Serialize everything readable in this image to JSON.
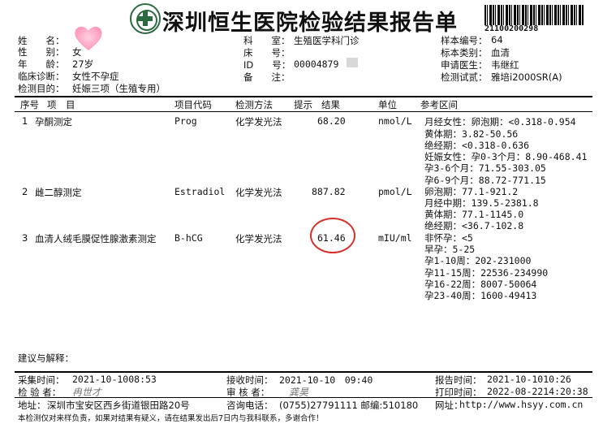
{
  "header": {
    "title": "深圳恒生医院检验结果报告单",
    "barcode_number": "21100200298"
  },
  "patient": {
    "name_label": "姓　　名：",
    "gender_label": "性　　别：",
    "gender": "女",
    "age_label": "年　　龄：",
    "age": "27岁",
    "diagnosis_label": "临床诊断：",
    "diagnosis": "女性不孕症",
    "purpose_label": "检测目的：",
    "purpose": "妊娠三项（生殖专用）",
    "dept_label": "科　　室：",
    "dept": "生殖医学科门诊",
    "bed_label": "床　　号：",
    "id_label": "ID　　号：",
    "id": "00004879",
    "remark_label": "备　　注：",
    "sample_no_label": "样本编号：",
    "sample_no": "64",
    "sample_type_label": "标本类别：",
    "sample_type": "血清",
    "doctor_label": "申请医生：",
    "doctor": "韦继红",
    "instrument_label": "检测试贰：",
    "instrument": "雅培i2000SR(A)"
  },
  "table": {
    "headers": {
      "seq": "序号",
      "item": "项　目",
      "code": "项目代码",
      "method": "检测方法",
      "hint": "提示",
      "result": "结果",
      "unit": "单位",
      "ref": "参考区间"
    },
    "rows": [
      {
        "seq": "1",
        "item": "孕酮测定",
        "code": "Prog",
        "method": "化学发光法",
        "result": "68.20",
        "unit": "nmol/L"
      },
      {
        "seq": "2",
        "item": "雌二醇测定",
        "code": "Estradiol",
        "method": "化学发光法",
        "result": "887.82",
        "unit": "pmol/L"
      },
      {
        "seq": "3",
        "item": "血清人绒毛膜促性腺激素测定",
        "code": "B-hCG",
        "method": "化学发光法",
        "result": "61.46",
        "unit": "mIU/ml"
      }
    ],
    "reference_lines": [
      "月经女性：卵泡期：<0.318-0.954",
      "黄体期：3.82-50.56",
      "绝经期：<0.318-0.636",
      "妊娠女性：孕0-3个月：8.90-468.41",
      "孕3-6个月：71.55-303.05",
      "孕6-9个月：88.72-771.15",
      "卵泡期：77.1-921.2",
      "月经中期：139.5-2381.8",
      "黄体期：77.1-1145.0",
      "绝经期：<36.7-102.8",
      "非怀孕：<5",
      "早孕：5-25",
      "孕1-10周：202-231000",
      "孕11-15周：22536-234990",
      "孕16-22周：8007-50064",
      "孕23-40周：1600-49413"
    ]
  },
  "footer": {
    "suggestion_label": "建议与解释：",
    "collect_label": "采集时间：",
    "collect_time": "2021-10-1008:53",
    "receive_label": "接收时间：",
    "receive_time": "2021-10-10　09:40",
    "report_label": "报告时间：",
    "report_time": "2021-10-1010:26",
    "tester_label": "检 验 者：",
    "tester_sign": "冉世才",
    "reviewer_label": "审 核 者：",
    "reviewer_sign": "龚昊",
    "print_label": "打印时间：",
    "print_time": "2022-08-2214:20:38",
    "address_label": "地址：",
    "address": "深圳市宝安区西乡街道银田路20号",
    "phone_label": "咨询电话：",
    "phone": "(0755)27791111 邮编:510180",
    "website_label": "网址：",
    "website": "http://www.hsyy.com.cn",
    "disclaimer": "本检测仅对来样负责，如果对结果有疑义，请在结果发出后7日内与我科联系，多谢合作！"
  },
  "colors": {
    "logo": "#2c6b3f",
    "circle": "#d6302a",
    "heart": "#ff9fbf"
  }
}
